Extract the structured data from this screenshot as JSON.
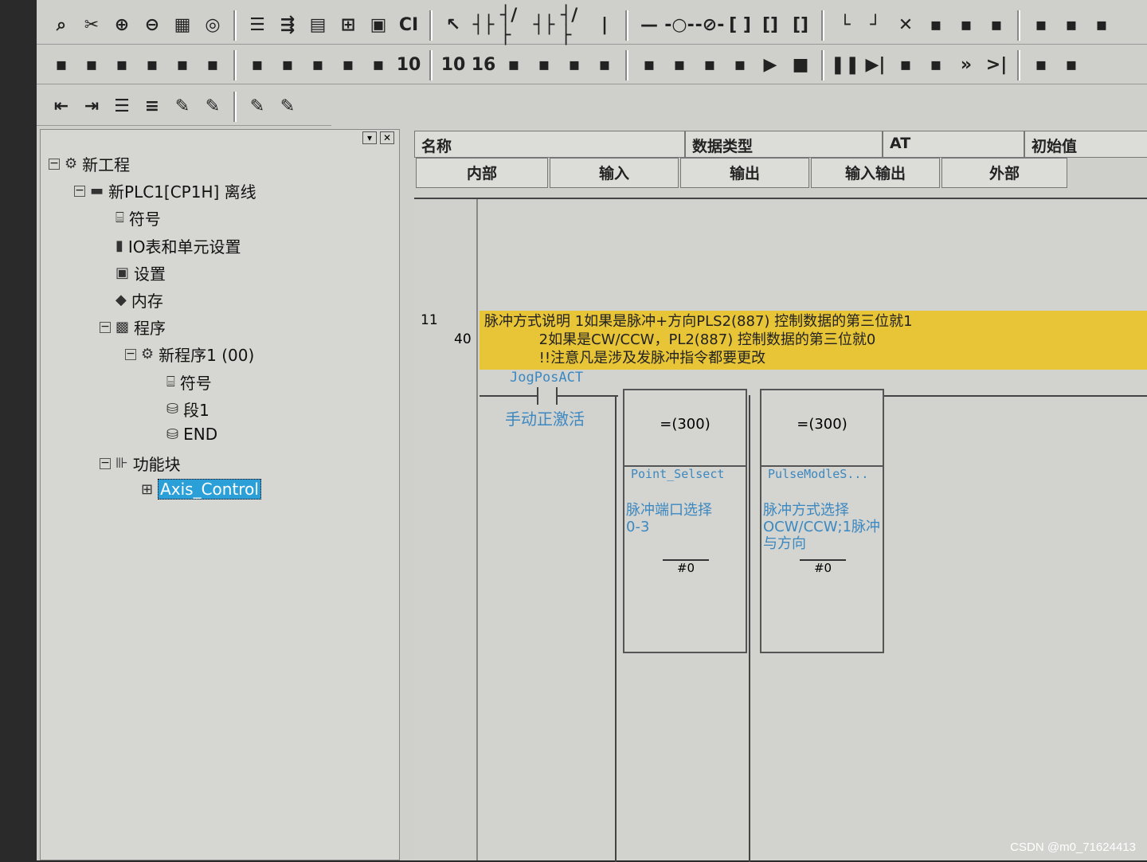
{
  "toolbar": {
    "row1": [
      "search",
      "cut",
      "zoom-in",
      "zoom-out",
      "grid",
      "monitor",
      "list",
      "cross-ref",
      "table",
      "tree",
      "instruction",
      "ci",
      "select",
      "contact-no",
      "contact-nc",
      "contact-or",
      "contact-or-nc",
      "line-v",
      "line-h",
      "coil",
      "coil-nc",
      "instr-box",
      "instr-box2",
      "instr-box3",
      "wire-down",
      "wire-corner",
      "delete",
      "online",
      "transfer",
      "upload",
      "compare",
      "diff",
      "edit"
    ],
    "row2": [
      "window",
      "edit-mode",
      "compile",
      "compile-all",
      "cut-window",
      "properties",
      "find",
      "replace",
      "io-table",
      "memory",
      "settings",
      "10",
      "10-bit",
      "16",
      "upload-plc",
      "download-plc",
      "upload-compare",
      "monitor-window",
      "data-trace",
      "online-edit",
      "force",
      "set",
      "run",
      "stop",
      "pause",
      "step",
      "step-in",
      "step-out",
      "fast-forward",
      "end-step",
      "misc1",
      "misc2"
    ],
    "row3": [
      "indent-left",
      "indent-right",
      "list",
      "list-numbered",
      "pen",
      "pen-a",
      "pen-b",
      "pen-c"
    ]
  },
  "tree": {
    "items": [
      {
        "label": "新工程",
        "icon": "project-icon"
      },
      {
        "label": "新PLC1[CP1H] 离线",
        "icon": "plc-icon"
      },
      {
        "label": "符号",
        "icon": "symbols-icon"
      },
      {
        "label": "IO表和单元设置",
        "icon": "io-table-icon"
      },
      {
        "label": "设置",
        "icon": "settings-icon"
      },
      {
        "label": "内存",
        "icon": "memory-icon"
      },
      {
        "label": "程序",
        "icon": "program-icon"
      },
      {
        "label": "新程序1 (00)",
        "icon": "program-file-icon"
      },
      {
        "label": "符号",
        "icon": "symbols-icon"
      },
      {
        "label": "段1",
        "icon": "section-icon"
      },
      {
        "label": "END",
        "icon": "section-icon"
      },
      {
        "label": "功能块",
        "icon": "function-block-icon"
      },
      {
        "label": "Axis_Control",
        "icon": "function-block-item-icon",
        "selected": true
      }
    ]
  },
  "vars": {
    "col_name": "名称",
    "col_type": "数据类型",
    "col_at": "AT",
    "col_init": "初始值",
    "tabs": [
      "内部",
      "输入",
      "输出",
      "输入输出",
      "外部"
    ]
  },
  "ladder": {
    "rung": "11",
    "step": "40",
    "comment": "脉冲方式说明 1如果是脉冲+方向PLS2(887) 控制数据的第三位就1\n            2如果是CW/CCW，PL2(887) 控制数据的第三位就0\n            !!注意凡是涉及发脉冲指令都要更改",
    "contact_name": "JogPosACT",
    "contact_comment": "手动正激活",
    "blocks": [
      {
        "instr": "=(300)",
        "operand": "Point_Selsect",
        "comment": "脉冲端口选择\n0-3",
        "value": "#0"
      },
      {
        "instr": "=(300)",
        "operand": "PulseModleS...",
        "comment": "脉冲方式选择\nOCW/CCW;1脉冲\n与方向",
        "value": "#0"
      }
    ]
  },
  "watermark": "CSDN @m0_71624413"
}
